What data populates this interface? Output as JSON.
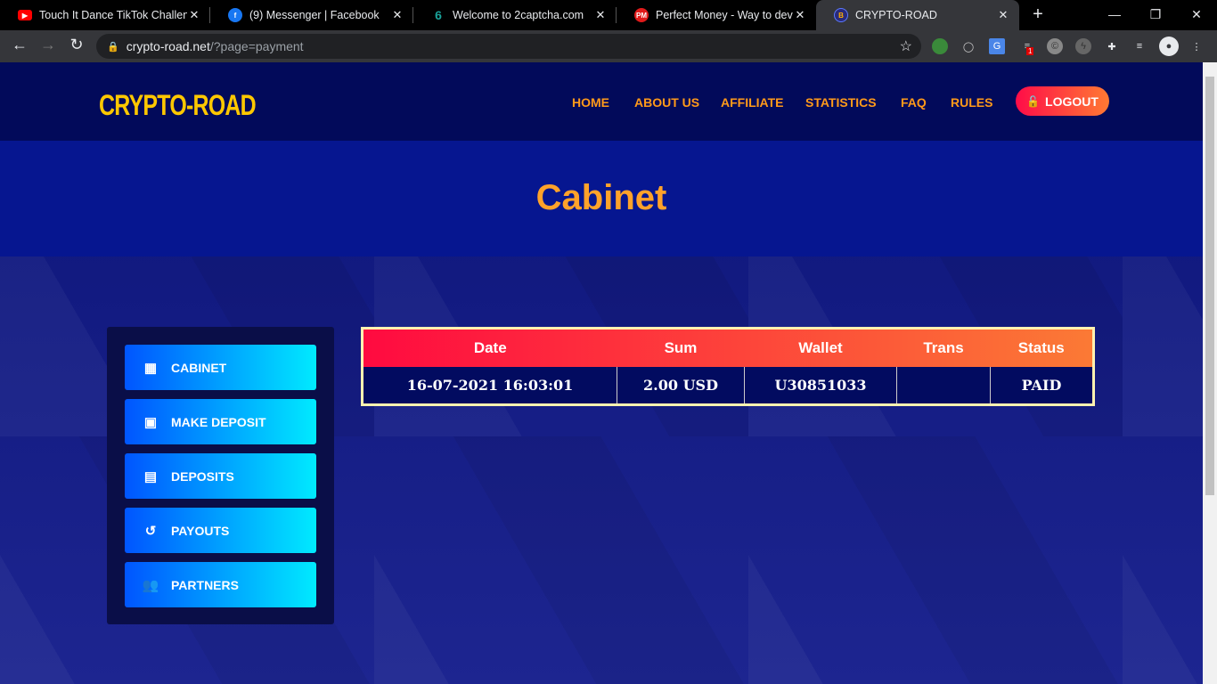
{
  "browser": {
    "tabs": [
      {
        "title": "Touch It Dance TikTok Challenge",
        "icon": "youtube-icon",
        "color": "#ff0000"
      },
      {
        "title": "(9) Messenger | Facebook",
        "icon": "facebook-icon",
        "color": "#1877f2"
      },
      {
        "title": "Welcome to 2captcha.com",
        "icon": "2captcha-icon",
        "color": "#1aa39a"
      },
      {
        "title": "Perfect Money - Way to develop",
        "icon": "perfect-money-icon",
        "color": "#e01a1a",
        "badge": "PM"
      },
      {
        "title": "CRYPTO-ROAD",
        "icon": "crypto-road-icon",
        "color": "#2a2a7a",
        "badge": "B"
      }
    ],
    "url_host": "crypto-road.net",
    "url_path": "/?page=payment",
    "ext_badge": "1"
  },
  "header": {
    "logo": "CRYPTO-ROAD",
    "menu": [
      "HOME",
      "ABOUT US",
      "AFFILIATE",
      "STATISTICS",
      "FAQ",
      "RULES"
    ],
    "logout": "LOGOUT"
  },
  "banner": {
    "title": "Cabinet"
  },
  "sidebar": [
    {
      "label": "CABINET",
      "icon": "grid-icon"
    },
    {
      "label": "MAKE DEPOSIT",
      "icon": "wallet-icon"
    },
    {
      "label": "DEPOSITS",
      "icon": "atm-icon"
    },
    {
      "label": "PAYOUTS",
      "icon": "history-icon"
    },
    {
      "label": "PARTNERS",
      "icon": "users-icon"
    }
  ],
  "table": {
    "headers": [
      "Date",
      "Sum",
      "Wallet",
      "Trans",
      "Status"
    ],
    "rows": [
      [
        "16-07-2021 16:03:01",
        "2.00 USD",
        "U30851033",
        "",
        "PAID"
      ]
    ]
  },
  "colors": {
    "accent": "#ff9a1a",
    "logo": "#ffc800",
    "header_bg": "#020a5a"
  }
}
